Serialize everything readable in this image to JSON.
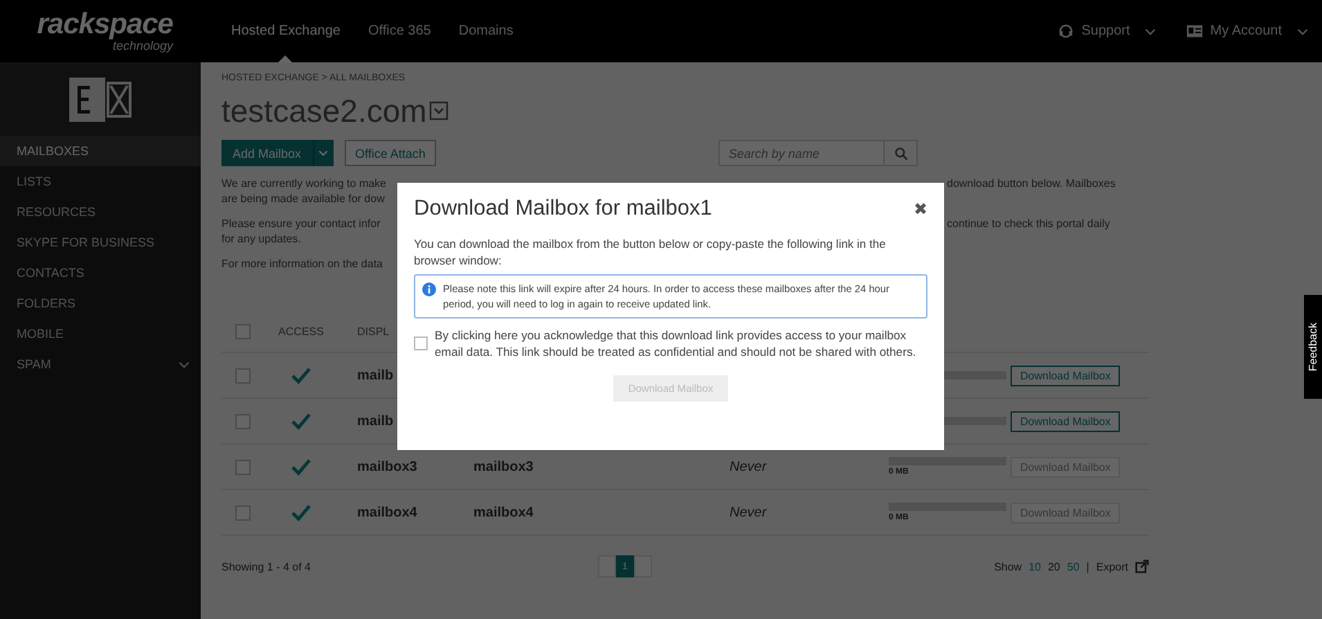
{
  "brand": {
    "name": "rackspace",
    "tagline": "technology"
  },
  "top_nav": [
    {
      "label": "Hosted Exchange",
      "selected": true
    },
    {
      "label": "Office 365",
      "selected": false
    },
    {
      "label": "Domains",
      "selected": false
    }
  ],
  "top_right": [
    {
      "kind": "support",
      "label": "Support"
    },
    {
      "kind": "account",
      "label": "My Account"
    }
  ],
  "sidebar": {
    "items": [
      {
        "label": "MAILBOXES",
        "selected": true,
        "expandable": false
      },
      {
        "label": "LISTS",
        "selected": false,
        "expandable": false
      },
      {
        "label": "RESOURCES",
        "selected": false,
        "expandable": false
      },
      {
        "label": "SKYPE FOR BUSINESS",
        "selected": false,
        "expandable": false
      },
      {
        "label": "CONTACTS",
        "selected": false,
        "expandable": false
      },
      {
        "label": "FOLDERS",
        "selected": false,
        "expandable": false
      },
      {
        "label": "MOBILE",
        "selected": false,
        "expandable": false
      },
      {
        "label": "SPAM",
        "selected": false,
        "expandable": true
      }
    ]
  },
  "breadcrumb": "HOSTED EXCHANGE > ALL MAILBOXES",
  "domain_title": "testcase2.com",
  "toolbar": {
    "add_button": "Add Mailbox",
    "office_attach_button": "Office Attach",
    "search": {
      "placeholder": "Search by name"
    }
  },
  "notices": [
    {
      "left": [
        "We are currently working to make",
        "are being made available for dow"
      ],
      "right": [
        "download button below. Mailboxes"
      ]
    },
    {
      "left": [
        "Please ensure your contact infor",
        "for any updates."
      ],
      "right": [
        "continue to check this portal daily"
      ]
    },
    {
      "left": [
        "For more information on the data"
      ]
    }
  ],
  "table": {
    "select_all": {
      "checked": false
    },
    "columns": [
      "ACCESS",
      "DISPL"
    ],
    "rows": [
      {
        "checked": false,
        "access": true,
        "display_name": "mailb",
        "download": "Download Mailbox",
        "disabled": false
      },
      {
        "checked": false,
        "access": true,
        "display_name": "mailb",
        "download": "Download Mailbox",
        "disabled": false
      },
      {
        "checked": false,
        "access": true,
        "display_name": "mailbox3",
        "column_4": "mailbox3",
        "last_login": "Never",
        "storage": "0 MB",
        "download": "Download Mailbox",
        "disabled": true
      },
      {
        "checked": false,
        "access": true,
        "display_name": "mailbox4",
        "column_4": "mailbox4",
        "last_login": "Never",
        "storage": "0 MB",
        "download": "Download Mailbox",
        "disabled": true
      }
    ]
  },
  "footer": {
    "showing": "Showing 1 - 4 of 4",
    "pages": [
      {
        "label": "1",
        "selected": true
      }
    ],
    "show_label": "Show",
    "page_sizes": [
      {
        "label": "10",
        "selected": false
      },
      {
        "label": "20",
        "selected": true
      },
      {
        "label": "50",
        "selected": false
      }
    ],
    "separator": "|",
    "export": "Export"
  },
  "feedback": "Feedback",
  "modal": {
    "title": "Download Mailbox for mailbox1",
    "close": "✖",
    "body": "You can download the mailbox from the button below or copy-paste the following link in the browser window:",
    "info": "Please note this link will expire after 24 hours. In order to access these mailboxes after the 24 hour period, you will need to log in again to receive updated link.",
    "acknowledge": {
      "checked": false,
      "label": "By clicking here you acknowledge that this download link provides access to your mailbox email data. This link should be treated as confidential and should not be shared with others."
    },
    "download_button": {
      "label": "Download Mailbox",
      "disabled": true
    }
  }
}
